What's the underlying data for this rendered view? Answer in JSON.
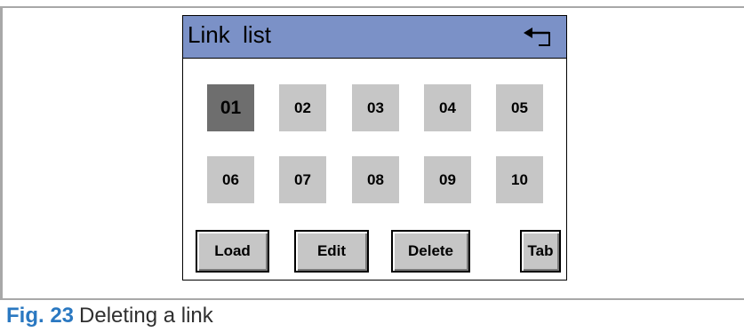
{
  "screen": {
    "title": "Link  list",
    "back_icon": "return-arrow-icon",
    "slots": [
      "01",
      "02",
      "03",
      "04",
      "05",
      "06",
      "07",
      "08",
      "09",
      "10"
    ],
    "selected_slot": "01",
    "buttons": {
      "load": "Load",
      "edit": "Edit",
      "delete": "Delete",
      "tab": "Tab"
    }
  },
  "caption": {
    "figure": "Fig. 23",
    "text": "Deleting a link"
  },
  "colors": {
    "titlebar": "#7b91c7",
    "slot": "#c6c6c6",
    "slot_selected": "#6e6e6e",
    "caption_accent": "#2a78c1"
  }
}
